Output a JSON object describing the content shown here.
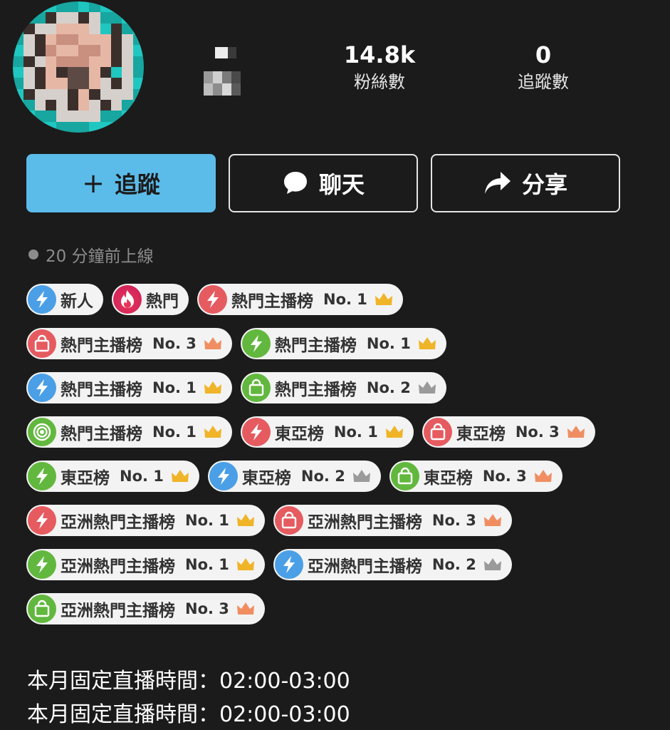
{
  "profile": {
    "stats": [
      {
        "value": "",
        "label": ""
      },
      {
        "value": "14.8k",
        "label": "粉絲數"
      },
      {
        "value": "0",
        "label": "追蹤數"
      }
    ]
  },
  "actions": {
    "follow_plus": "+",
    "follow_label": "追蹤",
    "chat_label": "聊天",
    "share_label": "分享"
  },
  "status": {
    "online_text": "20 分鐘前上線"
  },
  "colors": {
    "background": "#1b1b1b",
    "follow_button": "#5bbcea",
    "badge_bg": "#f3f3f3",
    "blue": "#4a9fe6",
    "red": "#e55b60",
    "green": "#62b83e",
    "crown_gold": "#f0b429",
    "crown_silver": "#9a9a9a",
    "crown_bronze": "#f08e62"
  },
  "badge_rows": [
    [
      {
        "icon": "bolt-icon",
        "color": "blue",
        "text": "新人",
        "no": "",
        "crown": ""
      },
      {
        "icon": "flame-icon",
        "color": "hot",
        "text": "熱門",
        "no": "",
        "crown": ""
      },
      {
        "icon": "bolt-icon",
        "color": "red",
        "text": "熱門主播榜",
        "no": "No. 1",
        "crown": "gold"
      }
    ],
    [
      {
        "icon": "bag-icon",
        "color": "red",
        "text": "熱門主播榜",
        "no": "No. 3",
        "crown": "bronze"
      },
      {
        "icon": "bolt-icon",
        "color": "green",
        "text": "熱門主播榜",
        "no": "No. 1",
        "crown": "gold"
      }
    ],
    [
      {
        "icon": "bolt-icon",
        "color": "blue",
        "text": "熱門主播榜",
        "no": "No. 1",
        "crown": "gold"
      },
      {
        "icon": "bag-icon",
        "color": "green",
        "text": "熱門主播榜",
        "no": "No. 2",
        "crown": "silver"
      }
    ],
    [
      {
        "icon": "target-icon",
        "color": "green",
        "text": "熱門主播榜",
        "no": "No. 1",
        "crown": "gold"
      },
      {
        "icon": "bolt-icon",
        "color": "red",
        "text": "東亞榜",
        "no": "No. 1",
        "crown": "gold"
      },
      {
        "icon": "bag-icon",
        "color": "red",
        "text": "東亞榜",
        "no": "No. 3",
        "crown": "bronze"
      }
    ],
    [
      {
        "icon": "bolt-icon",
        "color": "green",
        "text": "東亞榜",
        "no": "No. 1",
        "crown": "gold"
      },
      {
        "icon": "bolt-icon",
        "color": "blue",
        "text": "東亞榜",
        "no": "No. 2",
        "crown": "silver"
      },
      {
        "icon": "bag-icon",
        "color": "green",
        "text": "東亞榜",
        "no": "No. 3",
        "crown": "bronze"
      }
    ],
    [
      {
        "icon": "bolt-icon",
        "color": "red",
        "text": "亞洲熱門主播榜",
        "no": "No. 1",
        "crown": "gold"
      },
      {
        "icon": "bag-icon",
        "color": "red",
        "text": "亞洲熱門主播榜",
        "no": "No. 3",
        "crown": "bronze"
      }
    ],
    [
      {
        "icon": "bolt-icon",
        "color": "green",
        "text": "亞洲熱門主播榜",
        "no": "No. 1",
        "crown": "gold"
      },
      {
        "icon": "bolt-icon",
        "color": "blue",
        "text": "亞洲熱門主播榜",
        "no": "No. 2",
        "crown": "silver"
      }
    ],
    [
      {
        "icon": "bag-icon",
        "color": "green",
        "text": "亞洲熱門主播榜",
        "no": "No. 3",
        "crown": "bronze"
      }
    ]
  ],
  "schedule": [
    "本月固定直播時間：02:00-03:00",
    "本月固定直播時間：02:00-03:00"
  ]
}
